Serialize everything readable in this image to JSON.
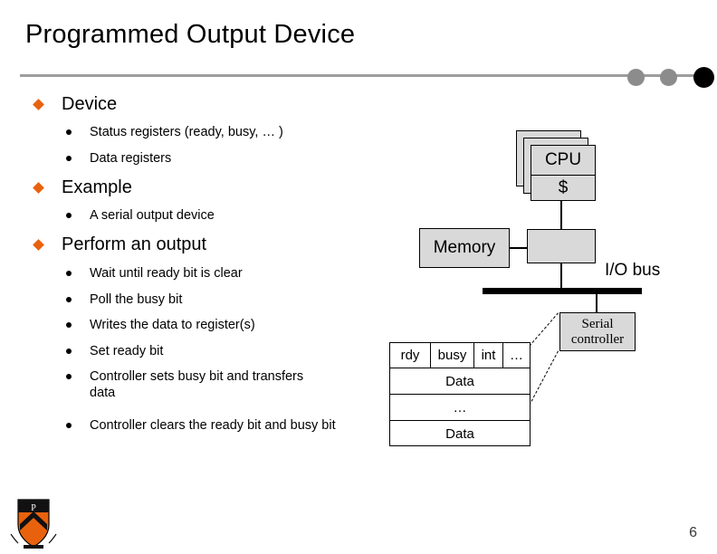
{
  "slide": {
    "title": "Programmed Output Device",
    "page_number": "6",
    "accent_color": "#E8620D",
    "rule_color": "#9d9d9d"
  },
  "decor": {
    "circle_1_color": "#8c8c8c",
    "circle_2_color": "#8c8c8c",
    "circle_3_color": "#000000"
  },
  "outline": [
    {
      "label": "Device",
      "children": [
        "Status registers (ready, busy, … )",
        "Data registers"
      ]
    },
    {
      "label": "Example",
      "children": [
        "A serial output device"
      ]
    },
    {
      "label": "Perform an output",
      "children": [
        "Wait until ready bit is clear",
        "Poll the busy bit",
        "Writes the data to register(s)",
        "Set ready bit",
        "Controller sets busy bit and transfers data",
        "Controller clears the ready bit and busy bit"
      ]
    }
  ],
  "diagram": {
    "cpu_label": "CPU",
    "cache_label": "$",
    "memory_label": "Memory",
    "bridge_label": "",
    "io_bus_label": "I/O bus",
    "serial_controller_line1": "Serial",
    "serial_controller_line2": "controller",
    "registers": {
      "status_cells": [
        "rdy",
        "busy",
        "int",
        "…"
      ],
      "rows": [
        "Data",
        "…",
        "Data"
      ]
    }
  }
}
